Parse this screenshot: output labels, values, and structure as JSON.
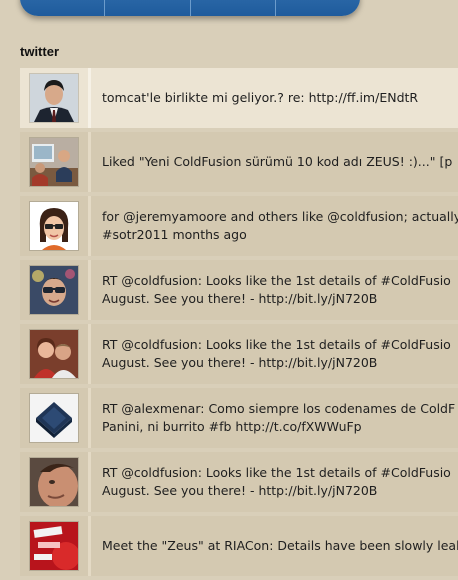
{
  "section": {
    "title": "twitter"
  },
  "tweets": [
    {
      "text": "tomcat'le birlikte mi geliyor.? re: http://ff.im/ENdtR",
      "avatar_icon": "avatar-man-suit"
    },
    {
      "text": "Liked \"Yeni ColdFusion sürümü 10 kod adı ZEUS! :)...\" [p",
      "avatar_icon": "avatar-office"
    },
    {
      "text": "for @jeremyamoore and others like @coldfusion; actually\n#sotr2011 months ago",
      "avatar_icon": "avatar-cartoon"
    },
    {
      "text": "RT @coldfusion: Looks like the 1st details of #ColdFusio\nAugust. See you there! - http://bit.ly/jN720B",
      "avatar_icon": "avatar-sunglasses"
    },
    {
      "text": "RT @coldfusion: Looks like the 1st details of #ColdFusio\nAugust. See you there! - http://bit.ly/jN720B",
      "avatar_icon": "avatar-couple"
    },
    {
      "text": "RT @alexmenar: Como siempre los codenames de ColdF\nPanini, ni burrito #fb http://t.co/fXWWuFp",
      "avatar_icon": "avatar-keyboard-key"
    },
    {
      "text": "RT @coldfusion: Looks like the 1st details of #ColdFusio\nAugust. See you there! - http://bit.ly/jN720B",
      "avatar_icon": "avatar-face-closeup"
    },
    {
      "text": "Meet the \"Zeus\" at RIACon: Details have been slowly leak",
      "avatar_icon": "avatar-red-logo"
    }
  ]
}
